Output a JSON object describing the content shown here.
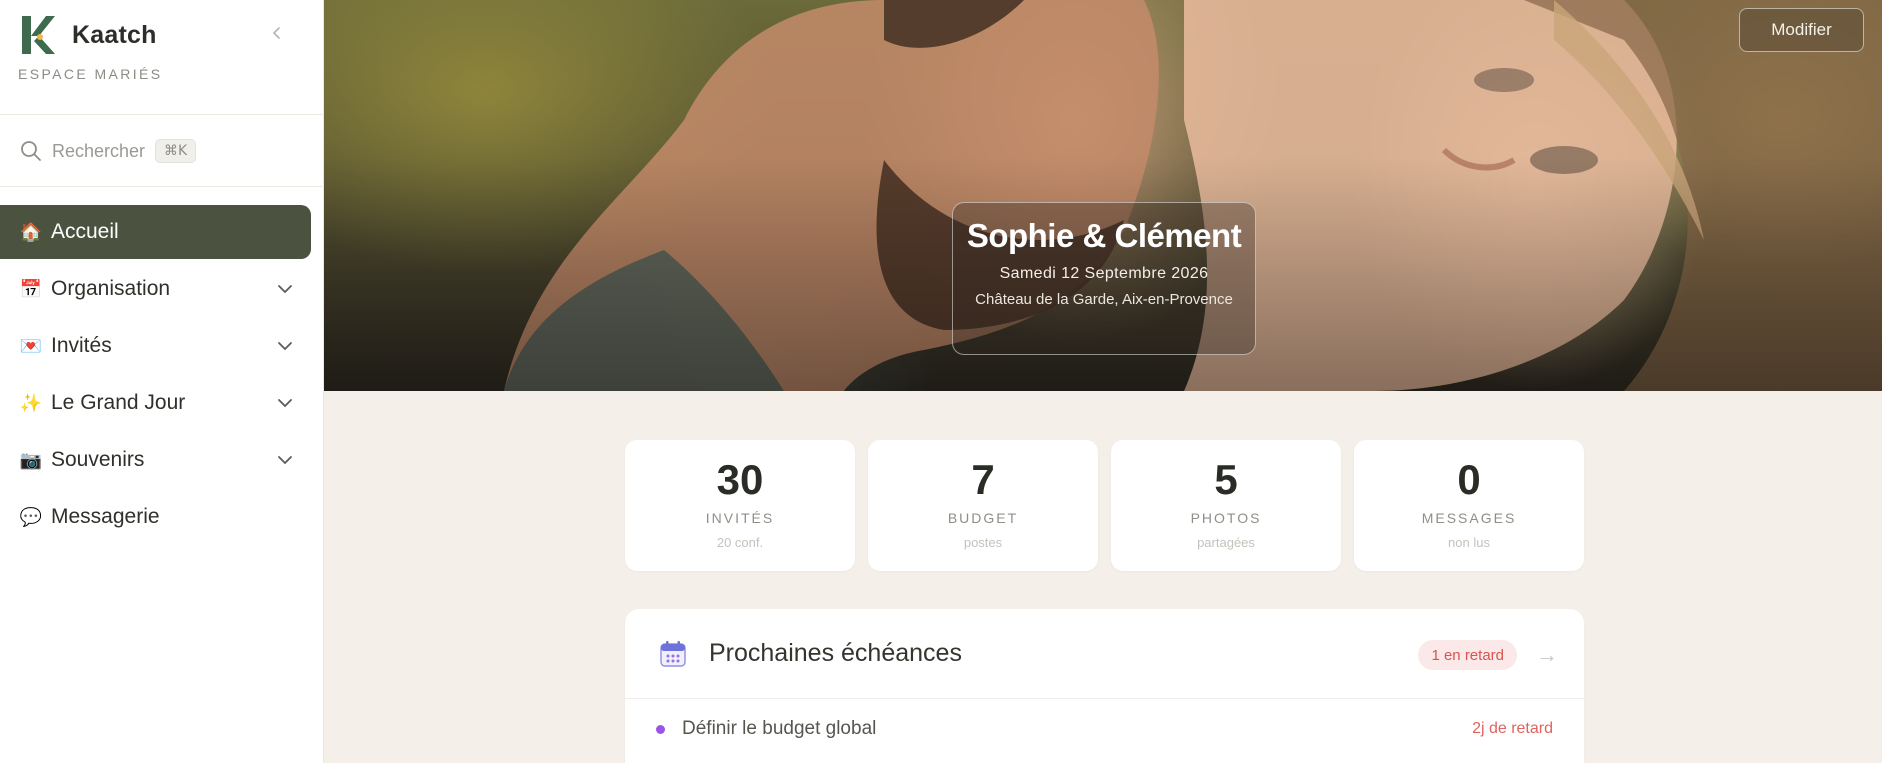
{
  "brand": {
    "name": "Kaatch",
    "subtitle": "ESPACE MARIÉS",
    "logo_color": "#3e6b4e"
  },
  "search": {
    "placeholder": "Rechercher",
    "shortcut": "⌘K"
  },
  "nav": {
    "items": [
      {
        "label": "Accueil",
        "icon": "house-emoji",
        "emoji": "🏠",
        "active": true,
        "expandable": false
      },
      {
        "label": "Organisation",
        "icon": "calendar-emoji",
        "emoji": "📅",
        "active": false,
        "expandable": true
      },
      {
        "label": "Invités",
        "icon": "love-letter-emoji",
        "emoji": "💌",
        "active": false,
        "expandable": true
      },
      {
        "label": "Le Grand Jour",
        "icon": "sparkles-emoji",
        "emoji": "✨",
        "active": false,
        "expandable": true
      },
      {
        "label": "Souvenirs",
        "icon": "camera-emoji",
        "emoji": "📷",
        "active": false,
        "expandable": true
      },
      {
        "label": "Messagerie",
        "icon": "speech-bubble-emoji",
        "emoji": "💬",
        "active": false,
        "expandable": false
      }
    ],
    "active_color": "#4b5240"
  },
  "hero": {
    "modify_label": "Modifier",
    "couple": "Sophie & Clément",
    "date": "Samedi 12 Septembre 2026",
    "venue": "Château de la Garde, Aix-en-Provence"
  },
  "stats": [
    {
      "value": "30",
      "label": "INVITÉS",
      "sub": "20 conf."
    },
    {
      "value": "7",
      "label": "BUDGET",
      "sub": "postes"
    },
    {
      "value": "5",
      "label": "PHOTOS",
      "sub": "partagées"
    },
    {
      "value": "0",
      "label": "MESSAGES",
      "sub": "non lus"
    }
  ],
  "deadlines": {
    "title": "Prochaines échéances",
    "late_badge": "1 en retard",
    "arrow": "→",
    "items": [
      {
        "label": "Définir le budget global",
        "status": "2j de retard",
        "dot_color": "#9b55e6"
      }
    ]
  }
}
